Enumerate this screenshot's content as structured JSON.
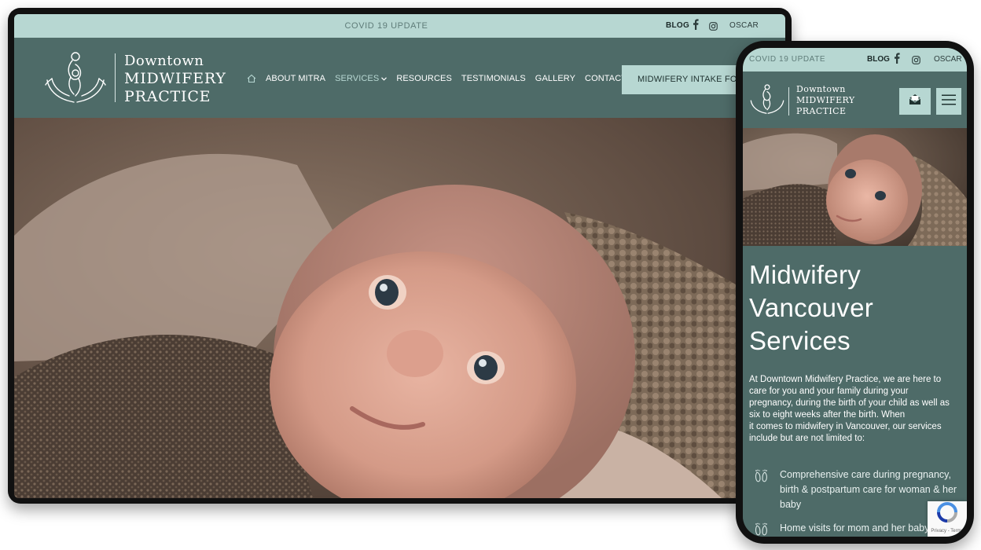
{
  "colors": {
    "header_bg": "#4e6b68",
    "topbar_bg": "#b7d7d2",
    "accent": "#b7d7d2",
    "text_light": "#ffffff"
  },
  "topbar": {
    "covid": "COVID 19 UPDATE",
    "blog": "BLOG",
    "oscar": "OSCAR",
    "facebook_icon": "facebook-icon",
    "instagram_icon": "instagram-icon"
  },
  "logo": {
    "line1": "Downtown",
    "line2": "MIDWIFERY",
    "line3": "PRACTICE",
    "icon": "mother-hands-logo-icon"
  },
  "nav": {
    "home_icon": "home-icon",
    "items": [
      {
        "label": "ABOUT MITRA"
      },
      {
        "label": "SERVICES"
      },
      {
        "label": "RESOURCES"
      },
      {
        "label": "TESTIMONIALS"
      },
      {
        "label": "GALLERY"
      },
      {
        "label": "CONTACT US"
      }
    ],
    "cta": "MIDWIFERY INTAKE FORM"
  },
  "hero": {
    "image": "newborn-baby-photo"
  },
  "mobile": {
    "form_icon": "envelope-form-icon",
    "menu_icon": "hamburger-menu-icon",
    "title_lines": [
      "Midwifery",
      "Vancouver",
      "Services"
    ],
    "intro_lines": [
      "At Downtown Midwifery Practice, we are here to",
      "care for you and your family during your",
      "pregnancy, during the birth of your child as well as",
      "six to eight weeks after the birth. When",
      "it comes to midwifery in Vancouver, our services",
      "include but are not limited to:"
    ],
    "bullets": [
      {
        "text": "Comprehensive care during pregnancy, birth & postpartum care for woman & her baby",
        "icon": "baby-feet-icon"
      },
      {
        "text": "Home visits for mom and her baby",
        "icon": "baby-feet-icon"
      }
    ],
    "recaptcha_text": "Privacy - Terms",
    "recaptcha_icon": "recaptcha-icon"
  }
}
